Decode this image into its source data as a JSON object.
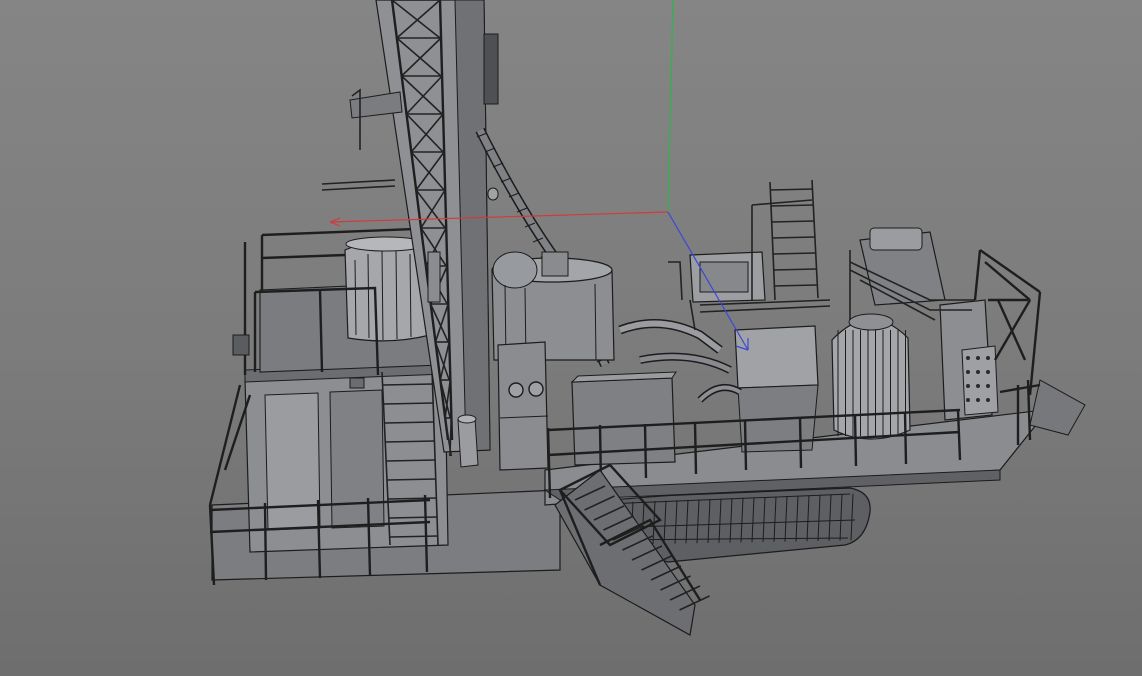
{
  "viewport": {
    "background_top": "#858585",
    "background_bottom": "#6e6e6e"
  },
  "colors": {
    "axis_x": "#d33a3a",
    "axis_y": "#2fb34a",
    "axis_z": "#3a48d6",
    "model_light": "#9ea0a4",
    "model_mid": "#8a8c90",
    "model_dark": "#6e7074",
    "model_shadow": "#55575b",
    "wireframe": "#1c1c1c"
  },
  "objects": [
    "drilling-rig-model",
    "world-axis-gizmo"
  ]
}
